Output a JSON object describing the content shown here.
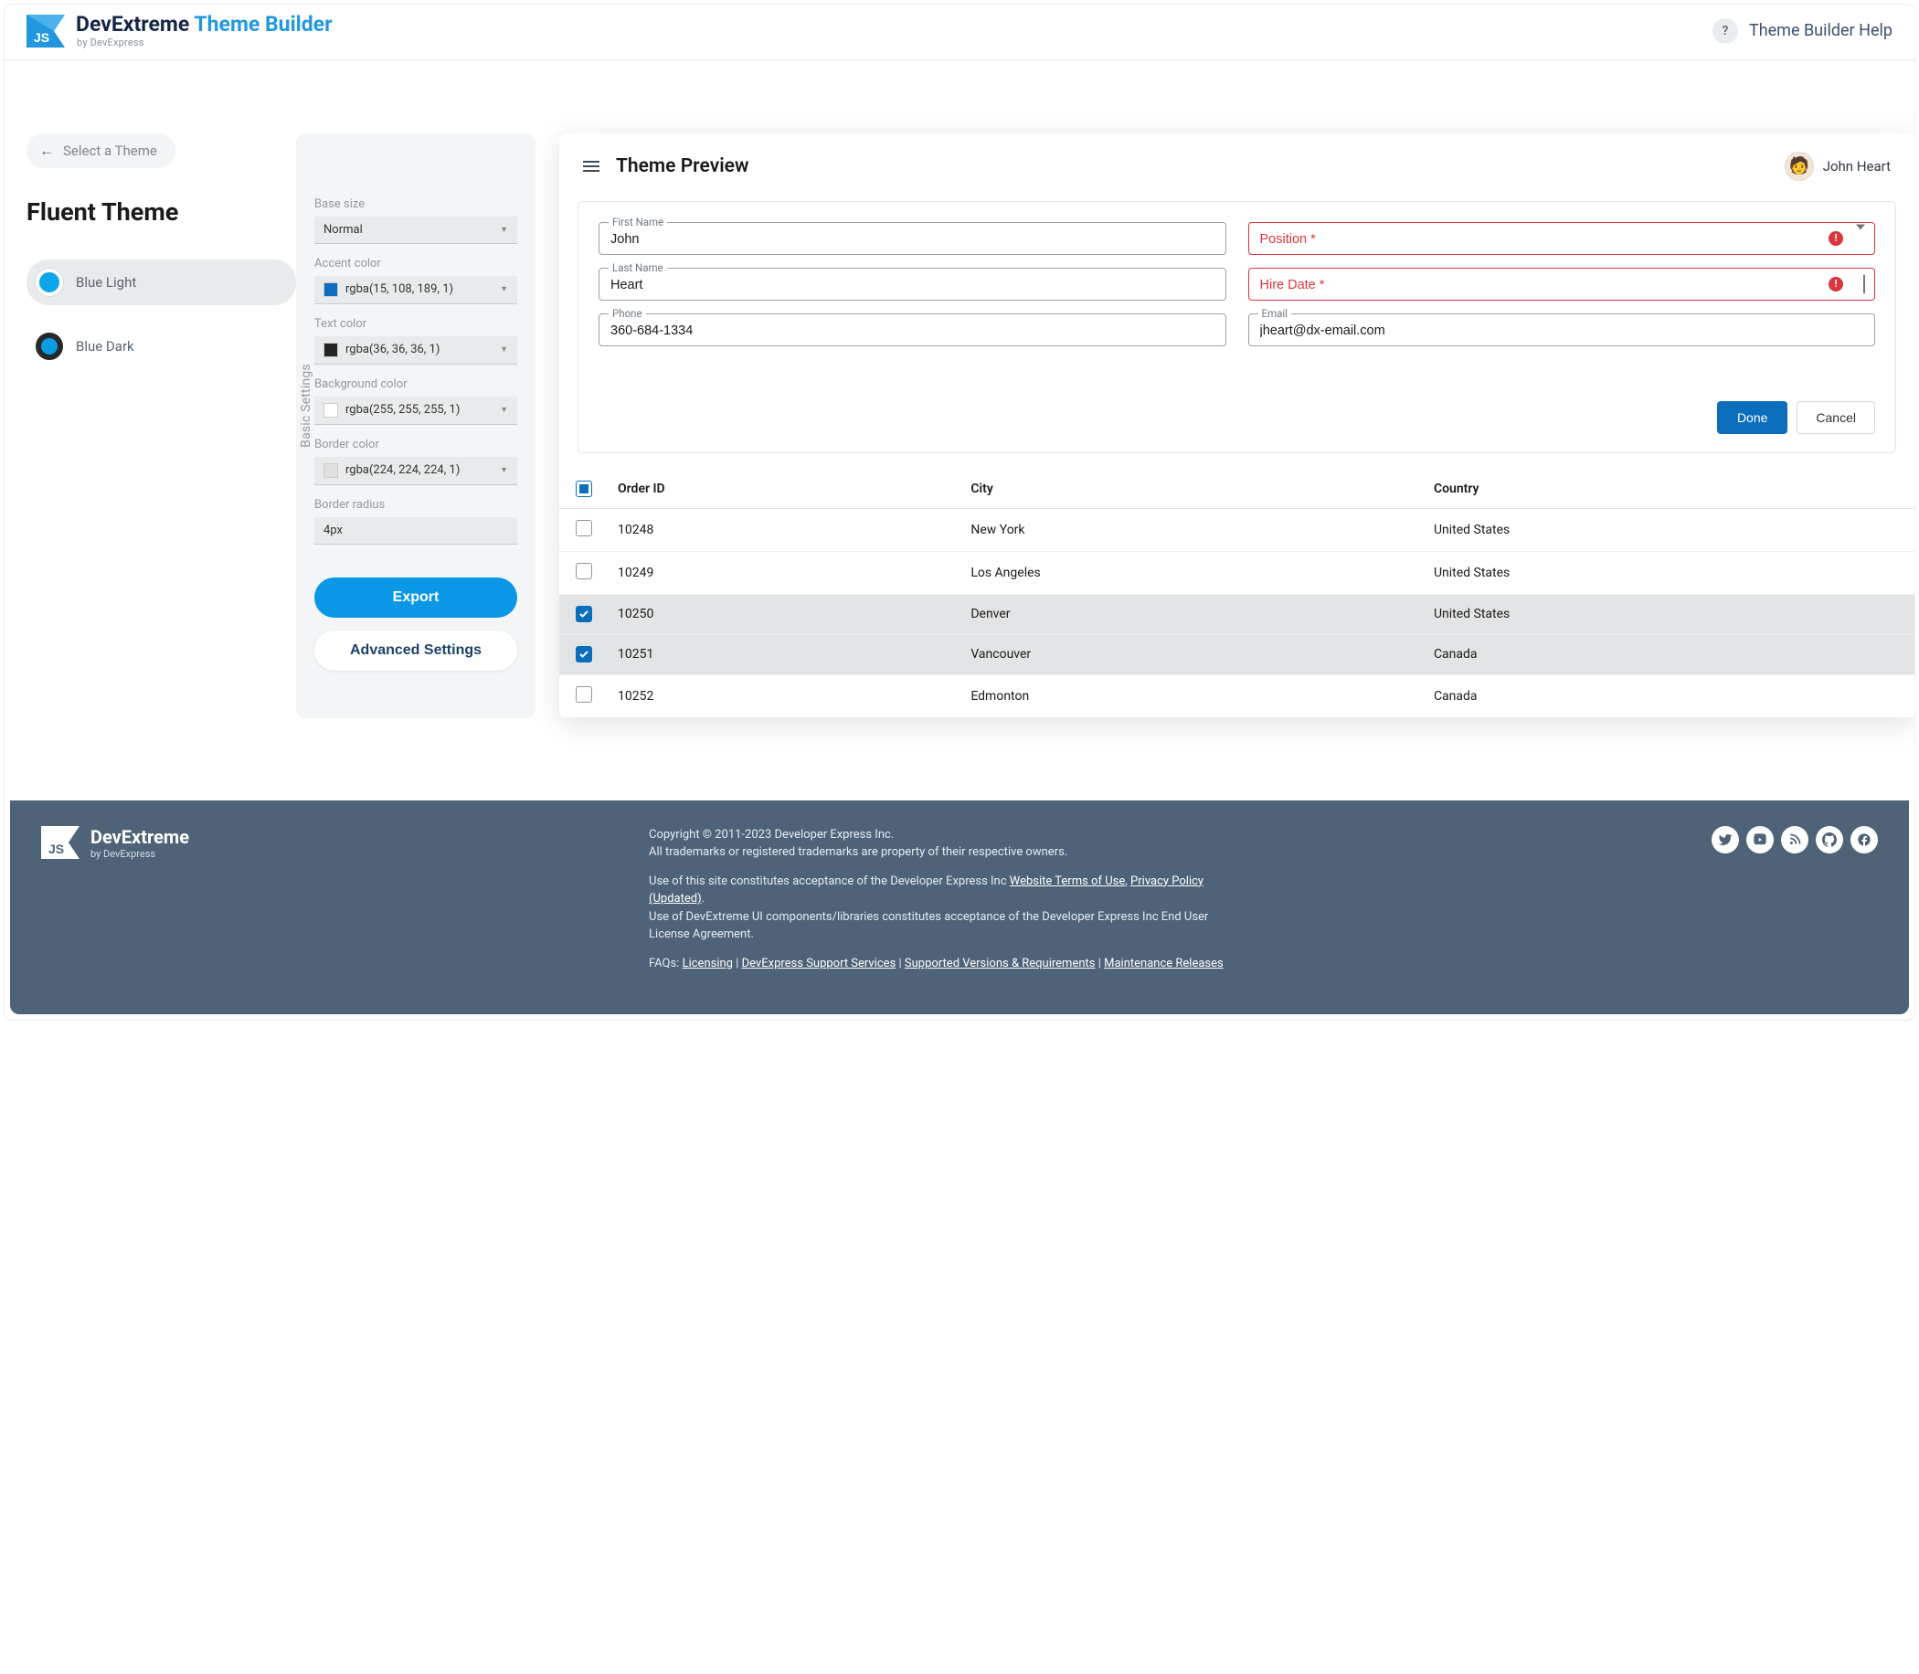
{
  "header": {
    "brand_main": "DevExtreme",
    "brand_sub": "Theme Builder",
    "brand_byline": "by DevExpress",
    "help_icon": "?",
    "help_label": "Theme Builder Help"
  },
  "left": {
    "back_label": "Select a Theme",
    "title": "Fluent Theme",
    "themes": [
      {
        "label": "Blue Light",
        "active": true
      },
      {
        "label": "Blue Dark",
        "active": false
      }
    ]
  },
  "settings": {
    "rotated_label": "Basic Settings",
    "items": [
      {
        "label": "Base size",
        "value": "Normal",
        "type": "select"
      },
      {
        "label": "Accent color",
        "value": "rgba(15, 108, 189, 1)",
        "chip": "#0f6cbd",
        "type": "color"
      },
      {
        "label": "Text color",
        "value": "rgba(36, 36, 36, 1)",
        "chip": "#242424",
        "type": "color"
      },
      {
        "label": "Background color",
        "value": "rgba(255, 255, 255, 1)",
        "chip": "#ffffff",
        "type": "color"
      },
      {
        "label": "Border color",
        "value": "rgba(224, 224, 224, 1)",
        "chip": "#e0e0e0",
        "type": "color"
      },
      {
        "label": "Border radius",
        "value": "4px",
        "type": "text"
      }
    ],
    "export_label": "Export",
    "advanced_label": "Advanced Settings"
  },
  "preview": {
    "title": "Theme Preview",
    "user_name": "John Heart",
    "form": {
      "first_name": {
        "label": "First Name",
        "value": "John"
      },
      "last_name": {
        "label": "Last Name",
        "value": "Heart"
      },
      "phone": {
        "label": "Phone",
        "value": "360-684-1334"
      },
      "position": {
        "label": "Position *"
      },
      "hire_date": {
        "label": "Hire Date *"
      },
      "email": {
        "label": "Email",
        "value": "jheart@dx-email.com"
      },
      "done_label": "Done",
      "cancel_label": "Cancel"
    },
    "grid": {
      "columns": [
        "",
        "Order ID",
        "City",
        "Country"
      ],
      "rows": [
        {
          "checked": false,
          "order_id": "10248",
          "city": "New York",
          "country": "United States"
        },
        {
          "checked": false,
          "order_id": "10249",
          "city": "Los Angeles",
          "country": "United States"
        },
        {
          "checked": true,
          "order_id": "10250",
          "city": "Denver",
          "country": "United States"
        },
        {
          "checked": true,
          "order_id": "10251",
          "city": "Vancouver",
          "country": "Canada"
        },
        {
          "checked": false,
          "order_id": "10252",
          "city": "Edmonton",
          "country": "Canada"
        }
      ]
    }
  },
  "footer": {
    "copyright": "Copyright © 2011-2023 Developer Express Inc.",
    "trademarks": "All trademarks or registered trademarks are property of their respective owners.",
    "terms_prefix": "Use of this site constitutes acceptance of the Developer Express Inc ",
    "terms_link1": "Website Terms of Use",
    "terms_sep": ", ",
    "terms_link2": "Privacy Policy (Updated)",
    "terms_suffix": ".",
    "eula": "Use of DevExtreme UI components/libraries constitutes acceptance of the Developer Express Inc End User License Agreement.",
    "faqs_label": "FAQs: ",
    "faq_links": [
      "Licensing",
      "DevExpress Support Services",
      "Supported Versions & Requirements",
      "Maintenance Releases"
    ]
  }
}
